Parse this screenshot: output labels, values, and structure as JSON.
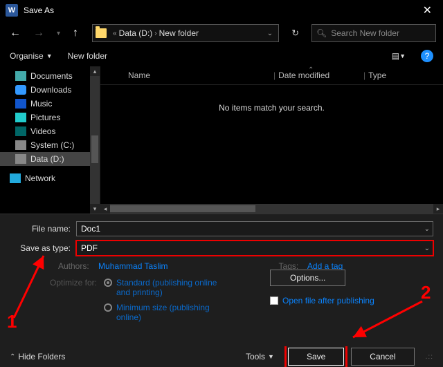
{
  "titlebar": {
    "title": "Save As"
  },
  "nav": {
    "crumb1": "Data (D:)",
    "crumb2": "New folder",
    "search_placeholder": "Search New folder"
  },
  "toolbar": {
    "organise": "Organise",
    "newfolder": "New folder"
  },
  "tree": {
    "items": [
      {
        "label": "Documents"
      },
      {
        "label": "Downloads"
      },
      {
        "label": "Music"
      },
      {
        "label": "Pictures"
      },
      {
        "label": "Videos"
      },
      {
        "label": "System (C:)"
      },
      {
        "label": "Data (D:)"
      },
      {
        "label": "Network"
      }
    ]
  },
  "columns": {
    "name": "Name",
    "date": "Date modified",
    "type": "Type"
  },
  "empty_msg": "No items match your search.",
  "form": {
    "filename_lbl": "File name:",
    "filename_val": "Doc1",
    "type_lbl": "Save as type:",
    "type_val": "PDF",
    "authors_lbl": "Authors:",
    "authors_val": "Muhammad Taslim",
    "tags_lbl": "Tags:",
    "tags_val": "Add a tag",
    "optimize_lbl": "Optimize for:",
    "opt_standard": "Standard (publishing online and printing)",
    "opt_min": "Minimum size (publishing online)",
    "options_btn": "Options...",
    "open_after": "Open file after publishing"
  },
  "footer": {
    "hide": "Hide Folders",
    "tools": "Tools",
    "save": "Save",
    "cancel": "Cancel"
  },
  "annotations": {
    "one": "1",
    "two": "2"
  }
}
